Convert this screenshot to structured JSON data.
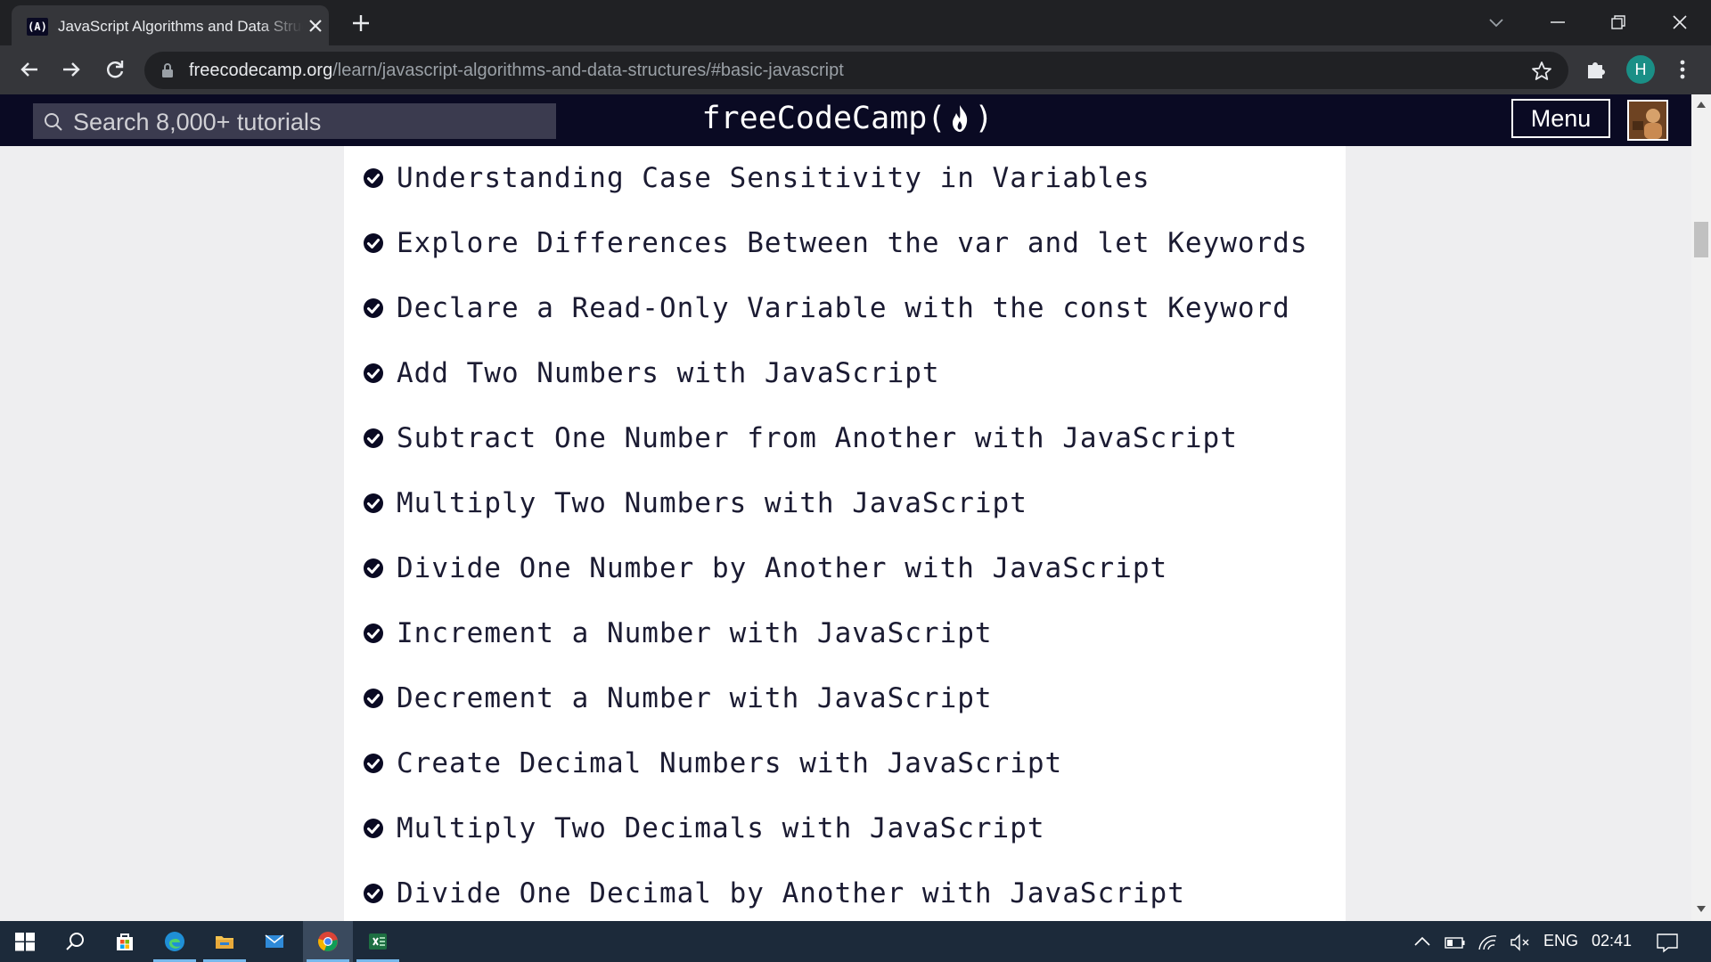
{
  "browser": {
    "tab": {
      "title": "JavaScript Algorithms and Data Structures",
      "favicon_text": "(A)"
    },
    "address": {
      "host": "freecodecamp.org",
      "path": "/learn/javascript-algorithms-and-data-structures/#basic-javascript"
    },
    "profile_initial": "H"
  },
  "fcc_nav": {
    "search_placeholder": "Search 8,000+ tutorials",
    "logo_text_left": "freeCodeCamp(",
    "logo_text_right": ")",
    "menu_label": "Menu"
  },
  "challenges": [
    {
      "label": "Understanding Case Sensitivity in Variables",
      "completed": true
    },
    {
      "label": "Explore Differences Between the var and let Keywords",
      "completed": true
    },
    {
      "label": "Declare a Read-Only Variable with the const Keyword",
      "completed": true
    },
    {
      "label": "Add Two Numbers with JavaScript",
      "completed": true
    },
    {
      "label": "Subtract One Number from Another with JavaScript",
      "completed": true
    },
    {
      "label": "Multiply Two Numbers with JavaScript",
      "completed": true
    },
    {
      "label": "Divide One Number by Another with JavaScript",
      "completed": true
    },
    {
      "label": "Increment a Number with JavaScript",
      "completed": true
    },
    {
      "label": "Decrement a Number with JavaScript",
      "completed": true
    },
    {
      "label": "Create Decimal Numbers with JavaScript",
      "completed": true
    },
    {
      "label": "Multiply Two Decimals with JavaScript",
      "completed": true
    },
    {
      "label": "Divide One Decimal by Another with JavaScript",
      "completed": true
    }
  ],
  "taskbar": {
    "language": "ENG",
    "time": "02:41",
    "apps": [
      "start-icon",
      "search-icon",
      "store-icon",
      "edge-icon",
      "file-explorer-icon",
      "mail-icon",
      "chrome-icon",
      "excel-icon"
    ]
  },
  "colors": {
    "fcc_nav_bg": "#0a0a23",
    "check": "#0a0a23",
    "chrome_dark": "#202124"
  }
}
